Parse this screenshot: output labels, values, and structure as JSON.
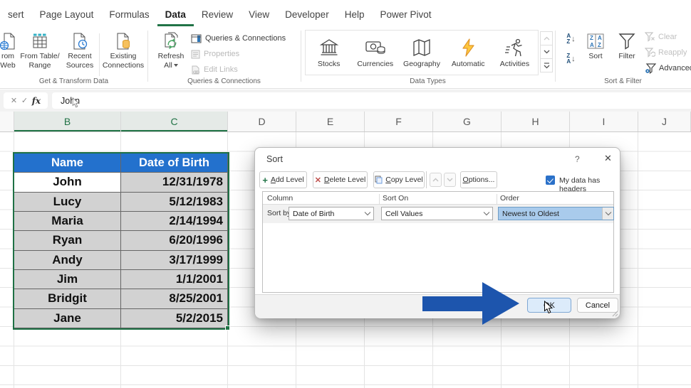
{
  "colors": {
    "accent_green": "#217346",
    "header_blue": "#2371cd",
    "selection_gray": "#d2d2d2",
    "arrow_blue": "#1d55ad",
    "order_highlight": "#a9cbec"
  },
  "tabs": {
    "items": [
      {
        "label": "sert",
        "active": false
      },
      {
        "label": "Page Layout",
        "active": false
      },
      {
        "label": "Formulas",
        "active": false
      },
      {
        "label": "Data",
        "active": true
      },
      {
        "label": "Review",
        "active": false
      },
      {
        "label": "View",
        "active": false
      },
      {
        "label": "Developer",
        "active": false
      },
      {
        "label": "Help",
        "active": false
      },
      {
        "label": "Power Pivot",
        "active": false
      }
    ]
  },
  "ribbon": {
    "group_labels": [
      "Get & Transform Data",
      "Queries & Connections",
      "Data Types",
      "Sort & Filter"
    ],
    "get_transform": {
      "from_web": [
        "rom",
        "Web"
      ],
      "from_table": [
        "From Table/",
        "Range"
      ],
      "recent_sources": [
        "Recent",
        "Sources"
      ],
      "existing_connections": [
        "Existing",
        "Connections"
      ]
    },
    "queries": {
      "refresh": [
        "Refresh",
        "All"
      ],
      "items": [
        "Queries & Connections",
        "Properties",
        "Edit Links"
      ]
    },
    "data_types": {
      "items": [
        "Stocks",
        "Currencies",
        "Geography",
        "Automatic",
        "Activities"
      ]
    },
    "sort_filter": {
      "sort": "Sort",
      "filter": "Filter",
      "clear": "Clear",
      "reapply": "Reapply",
      "advanced": "Advanced"
    }
  },
  "formula_bar": {
    "cancel": "✕",
    "enter": "✓",
    "fx": "fx",
    "value": "John"
  },
  "sheet": {
    "column_headers": [
      "B",
      "C",
      "D",
      "E",
      "F",
      "G",
      "H",
      "I",
      "J"
    ],
    "selected_columns": [
      "B",
      "C"
    ],
    "table": {
      "headers": [
        "Name",
        "Date of Birth"
      ],
      "rows": [
        [
          "John",
          "12/31/1978"
        ],
        [
          "Lucy",
          "5/12/1983"
        ],
        [
          "Maria",
          "2/14/1994"
        ],
        [
          "Ryan",
          "6/20/1996"
        ],
        [
          "Andy",
          "3/17/1999"
        ],
        [
          "Jim",
          "1/1/2001"
        ],
        [
          "Bridgit",
          "8/25/2001"
        ],
        [
          "Jane",
          "5/2/2015"
        ]
      ],
      "active_cell": "John"
    }
  },
  "dialog": {
    "title": "Sort",
    "help": "?",
    "close": "✕",
    "toolbar": {
      "add_level": "Add Level",
      "delete_level": "Delete Level",
      "copy_level": "Copy Level",
      "options": "Options...",
      "headers_label": "My data has headers",
      "headers_checked": true
    },
    "grid": {
      "col1": "Column",
      "col2": "Sort On",
      "col3": "Order",
      "row_label": "Sort by",
      "column_value": "Date of Birth",
      "sort_on_value": "Cell Values",
      "order_value": "Newest to Oldest"
    },
    "ok": "OK",
    "cancel": "Cancel"
  }
}
